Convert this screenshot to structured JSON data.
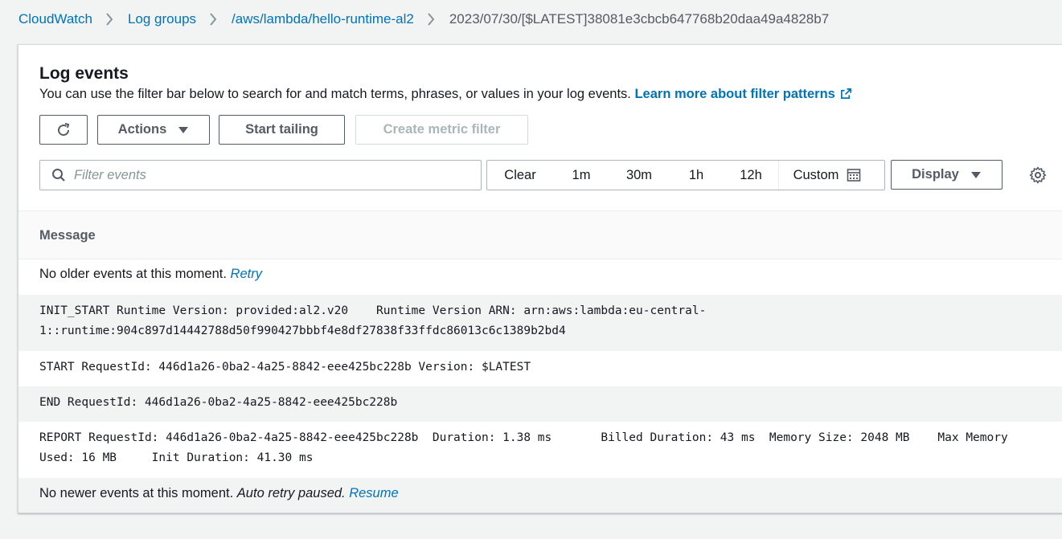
{
  "breadcrumb": {
    "items": [
      "CloudWatch",
      "Log groups",
      "/aws/lambda/hello-runtime-al2"
    ],
    "current": "2023/07/30/[$LATEST]38081e3cbcb647768b20daa49a4828b7"
  },
  "panel": {
    "title": "Log events",
    "description": "You can use the filter bar below to search for and match terms, phrases, or values in your log events.",
    "learn_more": "Learn more about filter patterns"
  },
  "toolbar": {
    "refresh_icon": "refresh-icon",
    "actions_label": "Actions",
    "start_tailing_label": "Start tailing",
    "create_metric_filter_label": "Create metric filter"
  },
  "filter": {
    "placeholder": "Filter events",
    "value": ""
  },
  "time_range": {
    "clear_label": "Clear",
    "options": [
      "1m",
      "30m",
      "1h",
      "12h"
    ],
    "custom_label": "Custom"
  },
  "display_label": "Display",
  "table": {
    "column": "Message"
  },
  "events": {
    "older_note": "No older events at this moment.",
    "older_retry": "Retry",
    "init_line1": "INIT_START Runtime Version: provided:al2.v20    Runtime Version ARN: arn:aws:lambda:eu-central-",
    "init_line2": "1::runtime:904c897d14442788d50f990427bbbf4e8df27838f33ffdc86013c6c1389b2bd4",
    "start_line": "START RequestId: 446d1a26-0ba2-4a25-8842-eee425bc228b Version: $LATEST",
    "end_line": "END RequestId: 446d1a26-0ba2-4a25-8842-eee425bc228b",
    "report_line1": "REPORT RequestId: 446d1a26-0ba2-4a25-8842-eee425bc228b  Duration: 1.38 ms       Billed Duration: 43 ms  Memory Size: 2048 MB    Max Memory",
    "report_line2": "Used: 16 MB     Init Duration: 41.30 ms",
    "newer_note": "No newer events at this moment.",
    "newer_paused": "Auto retry paused.",
    "newer_resume": "Resume"
  },
  "colors": {
    "link": "#0073bb",
    "text": "#16191f",
    "muted": "#545b64",
    "row_alt": "#f2f3f3"
  }
}
